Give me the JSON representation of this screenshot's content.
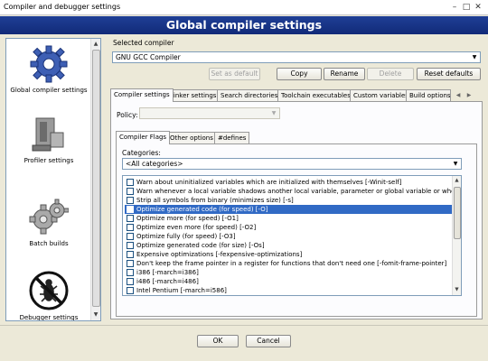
{
  "window": {
    "title": "Compiler and debugger settings",
    "minimize": "–",
    "maximize": "□",
    "close": "✕"
  },
  "banner": {
    "title": "Global compiler settings"
  },
  "sidebar": {
    "items": [
      {
        "label": "Global compiler settings",
        "icon": "gear-icon"
      },
      {
        "label": "Profiler settings",
        "icon": "caliper-icon"
      },
      {
        "label": "Batch builds",
        "icon": "gears-icon"
      },
      {
        "label": "Debugger settings",
        "icon": "bug-icon"
      }
    ]
  },
  "compiler": {
    "selected_label": "Selected compiler",
    "selected_value": "GNU GCC Compiler",
    "buttons": {
      "set_default": "Set as default",
      "copy": "Copy",
      "rename": "Rename",
      "delete": "Delete",
      "reset": "Reset defaults"
    }
  },
  "tabs": [
    "Compiler settings",
    "Linker settings",
    "Search directories",
    "Toolchain executables",
    "Custom variables",
    "Build options"
  ],
  "policy": {
    "label": "Policy:",
    "value": ""
  },
  "subtabs": [
    "Compiler Flags",
    "Other options",
    "#defines"
  ],
  "categories": {
    "label": "Categories:",
    "value": "<All categories>"
  },
  "flags": [
    {
      "text": "Warn about uninitialized variables which are initialized with themselves  [-Winit-self]",
      "checked": false
    },
    {
      "text": "Warn whenever a local variable shadows another local variable, parameter or global variable or whenever",
      "checked": false
    },
    {
      "text": "Strip all symbols from binary (minimizes size)  [-s]",
      "checked": false
    },
    {
      "text": "Optimize generated code (for speed)  [-O]",
      "checked": false,
      "selected": true
    },
    {
      "text": "Optimize more (for speed)  [-O1]",
      "checked": false
    },
    {
      "text": "Optimize even more (for speed)  [-O2]",
      "checked": false
    },
    {
      "text": "Optimize fully (for speed)  [-O3]",
      "checked": false
    },
    {
      "text": "Optimize generated code (for size)  [-Os]",
      "checked": false
    },
    {
      "text": "Expensive optimizations  [-fexpensive-optimizations]",
      "checked": false
    },
    {
      "text": "Don't keep the frame pointer in a register for functions that don't need one  [-fomit-frame-pointer]",
      "checked": false
    },
    {
      "text": "i386  [-march=i386]",
      "checked": false
    },
    {
      "text": "i486  [-march=i486]",
      "checked": false
    },
    {
      "text": "Intel Pentium  [-march=i586]",
      "checked": false
    }
  ],
  "footer": {
    "ok": "OK",
    "cancel": "Cancel"
  },
  "colors": {
    "banner": "#1f3f96",
    "selection": "#316ac5",
    "dialog_bg": "#ece9d8"
  }
}
